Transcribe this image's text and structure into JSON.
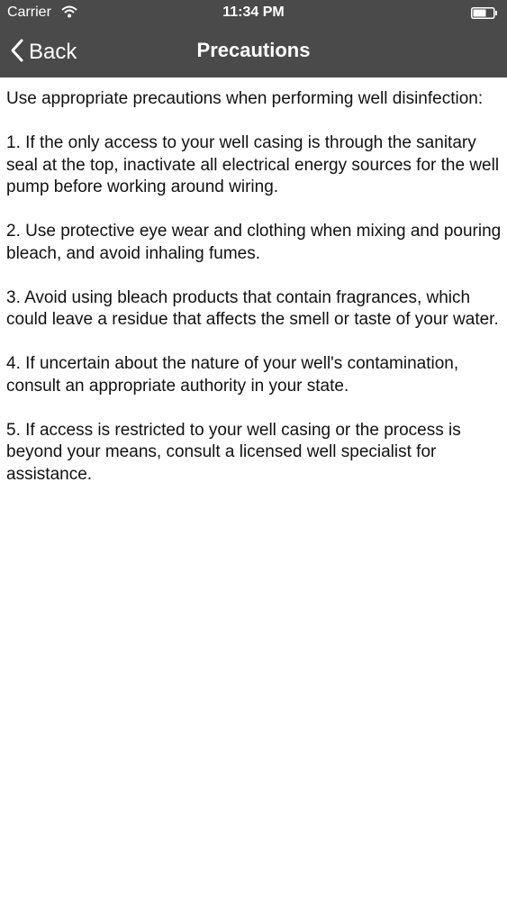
{
  "status_bar": {
    "carrier": "Carrier",
    "time": "11:34 PM",
    "wifi_icon": "wifi-icon",
    "battery_icon": "battery-icon"
  },
  "nav": {
    "back_label": "Back",
    "title": "Precautions",
    "back_icon": "chevron-left-icon"
  },
  "content": {
    "intro": "Use appropriate precautions when performing well disinfection:",
    "items": [
      "1.  If the only access to your well casing is through the sanitary seal at the top, inactivate all electrical energy sources for the well pump before working around wiring.",
      "2.  Use protective eye wear and clothing when mixing and pouring bleach, and avoid inhaling fumes.",
      "3.  Avoid using bleach products that contain fragrances, which could leave a residue that affects the smell or taste of your water.",
      "4.  If uncertain about the nature of your well's contamination, consult an appropriate authority in your state.",
      "5.  If access is restricted to your well casing or the process is beyond your means, consult a licensed well specialist for assistance."
    ]
  },
  "colors": {
    "nav_background": "#4a4a4a",
    "nav_text": "#ffffff",
    "body_text": "#111111"
  }
}
